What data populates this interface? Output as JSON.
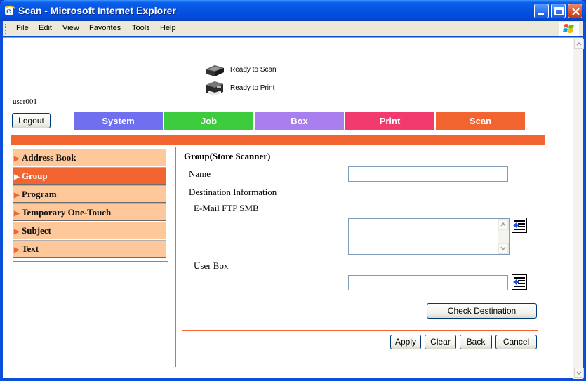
{
  "window": {
    "title": "Scan - Microsoft Internet Explorer"
  },
  "menu": [
    "File",
    "Edit",
    "View",
    "Favorites",
    "Tools",
    "Help"
  ],
  "status": [
    {
      "icon": "scanner-icon",
      "text": "Ready to Scan"
    },
    {
      "icon": "printer-icon",
      "text": "Ready to Print"
    }
  ],
  "user": {
    "name": "user001",
    "logout_label": "Logout"
  },
  "tabs": [
    {
      "label": "System",
      "color": "#6f6ff0"
    },
    {
      "label": "Job",
      "color": "#3dcc3d"
    },
    {
      "label": "Box",
      "color": "#a97ff0"
    },
    {
      "label": "Print",
      "color": "#f23a6f"
    },
    {
      "label": "Scan",
      "color": "#f26531"
    }
  ],
  "sidebar": {
    "items": [
      {
        "label": "Address Book",
        "active": false
      },
      {
        "label": "Group",
        "active": true
      },
      {
        "label": "Program",
        "active": false
      },
      {
        "label": "Temporary One-Touch",
        "active": false
      },
      {
        "label": "Subject",
        "active": false
      },
      {
        "label": "Text",
        "active": false
      }
    ]
  },
  "form": {
    "heading": "Group(Store Scanner)",
    "name_label": "Name",
    "name_value": "",
    "dest_info_label": "Destination Information",
    "email_label": "E-Mail FTP SMB",
    "email_value": "",
    "userbox_label": "User Box",
    "userbox_value": "",
    "check_destination_label": "Check Destination"
  },
  "actions": {
    "apply": "Apply",
    "clear": "Clear",
    "back": "Back",
    "cancel": "Cancel"
  },
  "colors": {
    "accent": "#f26531",
    "sidebar_bg": "#ffc89a"
  }
}
